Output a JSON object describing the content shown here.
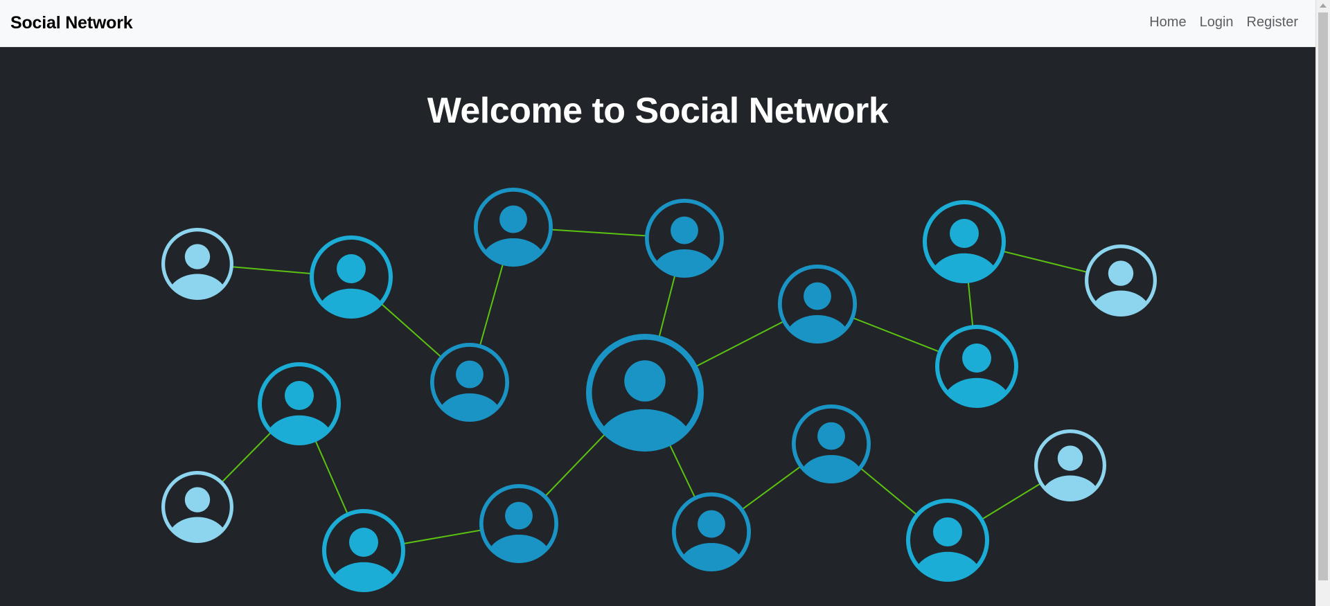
{
  "navbar": {
    "brand": "Social Network",
    "links": [
      "Home",
      "Login",
      "Register"
    ]
  },
  "hero": {
    "title": "Welcome to Social Network",
    "illustration": "user-network-illustration",
    "colors": {
      "background": "#212529",
      "link_line": "#5cc212",
      "node_light": "#8dd4ef",
      "node_mid": "#1badd6",
      "node_dark": "#1a94c4"
    }
  }
}
